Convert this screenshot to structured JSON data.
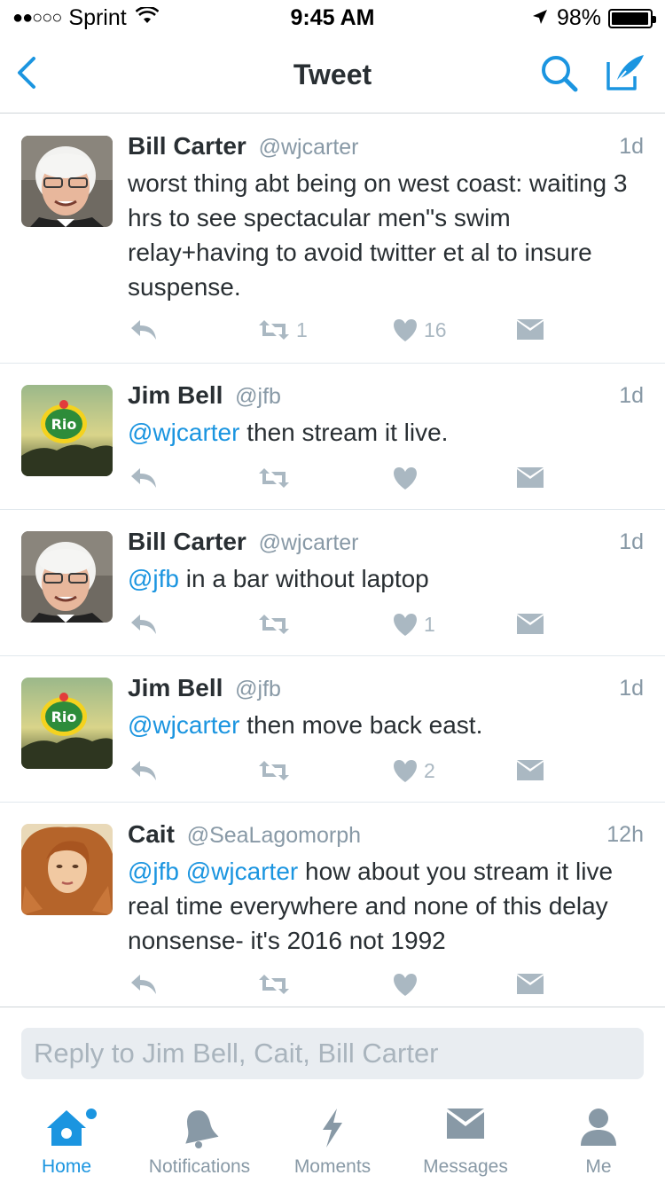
{
  "status_bar": {
    "carrier": "Sprint",
    "signal_dots": "●●○○○",
    "time": "9:45 AM",
    "battery_percent": "98%",
    "battery_level": 0.98
  },
  "nav": {
    "title": "Tweet",
    "icons": [
      "back-chevron-icon",
      "search-icon",
      "compose-icon"
    ]
  },
  "tweets": [
    {
      "name": "Bill Carter",
      "handle": "@wjcarter",
      "time": "1d",
      "mentions": "",
      "text": "worst thing abt being on west coast: waiting 3 hrs to see spectacular men\"s swim relay+having to avoid twitter et al to insure suspense.",
      "retweets": "1",
      "likes": "16"
    },
    {
      "name": "Jim Bell",
      "handle": "@jfb",
      "time": "1d",
      "mentions": "@wjcarter",
      "text": " then stream it live.",
      "retweets": "",
      "likes": ""
    },
    {
      "name": "Bill Carter",
      "handle": "@wjcarter",
      "time": "1d",
      "mentions": "@jfb",
      "text": " in a bar without laptop",
      "retweets": "",
      "likes": "1"
    },
    {
      "name": "Jim Bell",
      "handle": "@jfb",
      "time": "1d",
      "mentions": "@wjcarter",
      "text": " then move back east.",
      "retweets": "",
      "likes": "2"
    },
    {
      "name": "Cait",
      "handle": "@SeaLagomorph",
      "time": "12h",
      "mentions": "@jfb @wjcarter",
      "text": " how about you stream it live real time everywhere and none of this delay nonsense- it's 2016 not 1992",
      "retweets": "",
      "likes": ""
    }
  ],
  "avatar_rio_text": "Rio",
  "reply": {
    "placeholder": "Reply to Jim Bell, Cait, Bill Carter"
  },
  "tabs": [
    {
      "label": "Home",
      "icon": "home-icon",
      "active": true
    },
    {
      "label": "Notifications",
      "icon": "bell-icon",
      "active": false
    },
    {
      "label": "Moments",
      "icon": "lightning-icon",
      "active": false
    },
    {
      "label": "Messages",
      "icon": "envelope-icon",
      "active": false
    },
    {
      "label": "Me",
      "icon": "person-icon",
      "active": false
    }
  ],
  "colors": {
    "accent": "#1b95e0",
    "action_gray": "#aab8c2",
    "secondary_text": "#8899a6"
  }
}
